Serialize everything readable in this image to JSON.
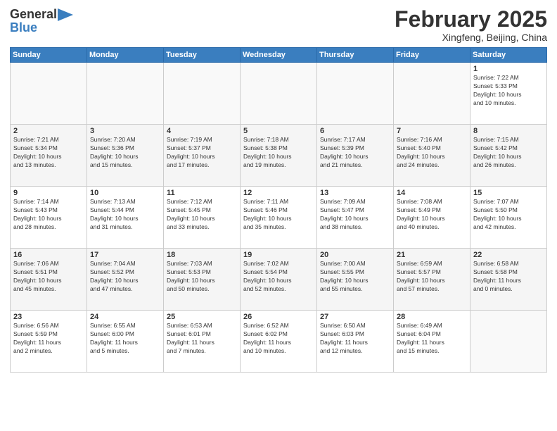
{
  "logo": {
    "general": "General",
    "blue": "Blue"
  },
  "header": {
    "month": "February 2025",
    "location": "Xingfeng, Beijing, China"
  },
  "weekdays": [
    "Sunday",
    "Monday",
    "Tuesday",
    "Wednesday",
    "Thursday",
    "Friday",
    "Saturday"
  ],
  "weeks": [
    [
      {
        "day": "",
        "info": ""
      },
      {
        "day": "",
        "info": ""
      },
      {
        "day": "",
        "info": ""
      },
      {
        "day": "",
        "info": ""
      },
      {
        "day": "",
        "info": ""
      },
      {
        "day": "",
        "info": ""
      },
      {
        "day": "1",
        "info": "Sunrise: 7:22 AM\nSunset: 5:33 PM\nDaylight: 10 hours\nand 10 minutes."
      }
    ],
    [
      {
        "day": "2",
        "info": "Sunrise: 7:21 AM\nSunset: 5:34 PM\nDaylight: 10 hours\nand 13 minutes."
      },
      {
        "day": "3",
        "info": "Sunrise: 7:20 AM\nSunset: 5:36 PM\nDaylight: 10 hours\nand 15 minutes."
      },
      {
        "day": "4",
        "info": "Sunrise: 7:19 AM\nSunset: 5:37 PM\nDaylight: 10 hours\nand 17 minutes."
      },
      {
        "day": "5",
        "info": "Sunrise: 7:18 AM\nSunset: 5:38 PM\nDaylight: 10 hours\nand 19 minutes."
      },
      {
        "day": "6",
        "info": "Sunrise: 7:17 AM\nSunset: 5:39 PM\nDaylight: 10 hours\nand 21 minutes."
      },
      {
        "day": "7",
        "info": "Sunrise: 7:16 AM\nSunset: 5:40 PM\nDaylight: 10 hours\nand 24 minutes."
      },
      {
        "day": "8",
        "info": "Sunrise: 7:15 AM\nSunset: 5:42 PM\nDaylight: 10 hours\nand 26 minutes."
      }
    ],
    [
      {
        "day": "9",
        "info": "Sunrise: 7:14 AM\nSunset: 5:43 PM\nDaylight: 10 hours\nand 28 minutes."
      },
      {
        "day": "10",
        "info": "Sunrise: 7:13 AM\nSunset: 5:44 PM\nDaylight: 10 hours\nand 31 minutes."
      },
      {
        "day": "11",
        "info": "Sunrise: 7:12 AM\nSunset: 5:45 PM\nDaylight: 10 hours\nand 33 minutes."
      },
      {
        "day": "12",
        "info": "Sunrise: 7:11 AM\nSunset: 5:46 PM\nDaylight: 10 hours\nand 35 minutes."
      },
      {
        "day": "13",
        "info": "Sunrise: 7:09 AM\nSunset: 5:47 PM\nDaylight: 10 hours\nand 38 minutes."
      },
      {
        "day": "14",
        "info": "Sunrise: 7:08 AM\nSunset: 5:49 PM\nDaylight: 10 hours\nand 40 minutes."
      },
      {
        "day": "15",
        "info": "Sunrise: 7:07 AM\nSunset: 5:50 PM\nDaylight: 10 hours\nand 42 minutes."
      }
    ],
    [
      {
        "day": "16",
        "info": "Sunrise: 7:06 AM\nSunset: 5:51 PM\nDaylight: 10 hours\nand 45 minutes."
      },
      {
        "day": "17",
        "info": "Sunrise: 7:04 AM\nSunset: 5:52 PM\nDaylight: 10 hours\nand 47 minutes."
      },
      {
        "day": "18",
        "info": "Sunrise: 7:03 AM\nSunset: 5:53 PM\nDaylight: 10 hours\nand 50 minutes."
      },
      {
        "day": "19",
        "info": "Sunrise: 7:02 AM\nSunset: 5:54 PM\nDaylight: 10 hours\nand 52 minutes."
      },
      {
        "day": "20",
        "info": "Sunrise: 7:00 AM\nSunset: 5:55 PM\nDaylight: 10 hours\nand 55 minutes."
      },
      {
        "day": "21",
        "info": "Sunrise: 6:59 AM\nSunset: 5:57 PM\nDaylight: 10 hours\nand 57 minutes."
      },
      {
        "day": "22",
        "info": "Sunrise: 6:58 AM\nSunset: 5:58 PM\nDaylight: 11 hours\nand 0 minutes."
      }
    ],
    [
      {
        "day": "23",
        "info": "Sunrise: 6:56 AM\nSunset: 5:59 PM\nDaylight: 11 hours\nand 2 minutes."
      },
      {
        "day": "24",
        "info": "Sunrise: 6:55 AM\nSunset: 6:00 PM\nDaylight: 11 hours\nand 5 minutes."
      },
      {
        "day": "25",
        "info": "Sunrise: 6:53 AM\nSunset: 6:01 PM\nDaylight: 11 hours\nand 7 minutes."
      },
      {
        "day": "26",
        "info": "Sunrise: 6:52 AM\nSunset: 6:02 PM\nDaylight: 11 hours\nand 10 minutes."
      },
      {
        "day": "27",
        "info": "Sunrise: 6:50 AM\nSunset: 6:03 PM\nDaylight: 11 hours\nand 12 minutes."
      },
      {
        "day": "28",
        "info": "Sunrise: 6:49 AM\nSunset: 6:04 PM\nDaylight: 11 hours\nand 15 minutes."
      },
      {
        "day": "",
        "info": ""
      }
    ]
  ]
}
